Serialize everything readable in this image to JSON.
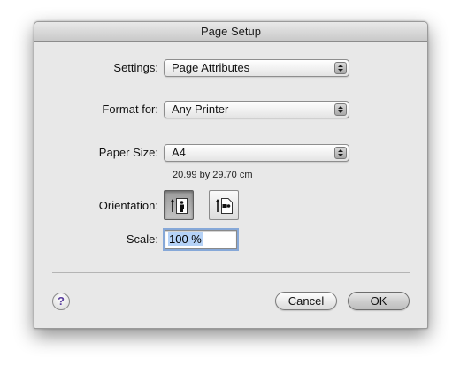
{
  "window": {
    "title": "Page Setup"
  },
  "settings": {
    "label": "Settings:",
    "value": "Page Attributes"
  },
  "format_for": {
    "label": "Format for:",
    "value": "Any Printer"
  },
  "paper_size": {
    "label": "Paper Size:",
    "value": "A4",
    "dimensions": "20.99 by 29.70 cm"
  },
  "orientation": {
    "label": "Orientation:",
    "options": [
      {
        "name": "portrait",
        "icon": "portrait-icon",
        "selected": true
      },
      {
        "name": "landscape",
        "icon": "landscape-icon",
        "selected": false
      }
    ]
  },
  "scale": {
    "label": "Scale:",
    "value": "100 %"
  },
  "buttons": {
    "help": "?",
    "cancel": "Cancel",
    "ok": "OK"
  },
  "colors": {
    "selection": "#b5d2f7",
    "help_glyph": "#5a3e9e",
    "focus_ring": "#86a8d8"
  }
}
